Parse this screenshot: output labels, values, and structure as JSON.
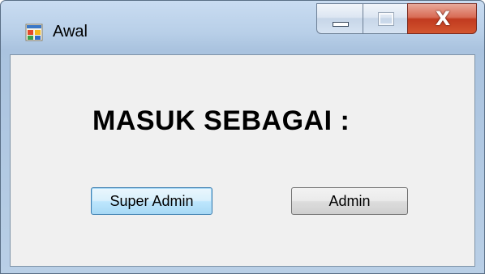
{
  "window": {
    "title": "Awal",
    "close_glyph": "X",
    "icons": {
      "app": "app-window-icon",
      "minimize": "minimize-icon",
      "maximize": "maximize-icon",
      "close": "close-icon"
    }
  },
  "form": {
    "heading": "MASUK SEBAGAI :",
    "buttons": {
      "super_admin": "Super Admin",
      "admin": "Admin"
    }
  },
  "colors": {
    "focused_button_border": "#3c7fb1",
    "close_button": "#c13a1f"
  }
}
